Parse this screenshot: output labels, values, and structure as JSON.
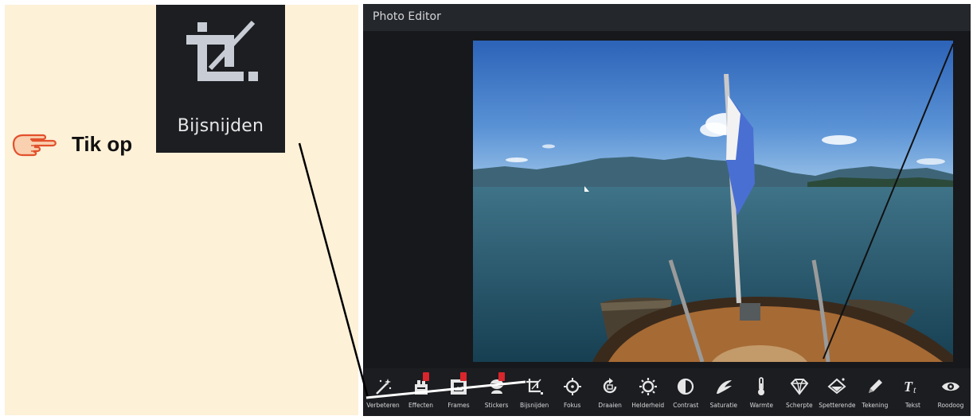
{
  "instruction": {
    "text": "Tik op",
    "icon": "pointing-hand-icon"
  },
  "callout": {
    "label": "Bijsnijden",
    "icon": "crop-icon"
  },
  "app": {
    "title": "Photo Editor"
  },
  "toolbar": {
    "tools": [
      {
        "label": "Verbeteren",
        "icon": "magic-wand-icon",
        "badge": false
      },
      {
        "label": "Effecten",
        "icon": "effects-icon",
        "badge": true
      },
      {
        "label": "Frames",
        "icon": "frame-icon",
        "badge": true
      },
      {
        "label": "Stickers",
        "icon": "sticker-icon",
        "badge": true
      },
      {
        "label": "Bijsnijden",
        "icon": "crop-icon",
        "badge": false
      },
      {
        "label": "Fokus",
        "icon": "focus-icon",
        "badge": false
      },
      {
        "label": "Draaien",
        "icon": "rotate-icon",
        "badge": false
      },
      {
        "label": "Helderheid",
        "icon": "brightness-icon",
        "badge": false
      },
      {
        "label": "Contrast",
        "icon": "contrast-icon",
        "badge": false
      },
      {
        "label": "Saturatie",
        "icon": "saturation-icon",
        "badge": false
      },
      {
        "label": "Warmte",
        "icon": "thermometer-icon",
        "badge": false
      },
      {
        "label": "Scherpte",
        "icon": "diamond-icon",
        "badge": false
      },
      {
        "label": "Spetterende",
        "icon": "splash-icon",
        "badge": false
      },
      {
        "label": "Tekening",
        "icon": "pencil-icon",
        "badge": false
      },
      {
        "label": "Tekst",
        "icon": "text-icon",
        "badge": false
      },
      {
        "label": "Roodoog",
        "icon": "eye-icon",
        "badge": false
      }
    ]
  },
  "colors": {
    "instruction_bg": "#fdf1d8",
    "editor_bg": "#15171a",
    "toolbar_bg": "#1b1d21",
    "badge": "#d8262c"
  }
}
